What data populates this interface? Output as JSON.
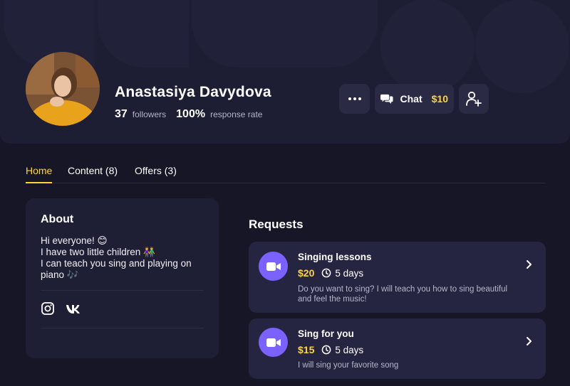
{
  "profile": {
    "name": "Anastasiya Davydova",
    "followers_count": "37",
    "followers_label": "followers",
    "response_rate": "100%",
    "response_label": "response rate"
  },
  "actions": {
    "more_icon": "more-horizontal-icon",
    "chat_label": "Chat",
    "chat_price": "$10",
    "follow_icon": "user-plus-icon"
  },
  "tabs": [
    {
      "label": "Home",
      "active": true
    },
    {
      "label": "Content (8)",
      "active": false
    },
    {
      "label": "Offers (3)",
      "active": false
    }
  ],
  "about": {
    "title": "About",
    "lines": [
      "Hi everyone! 😊",
      "I have two little children 👫",
      "I can teach you sing and playing on",
      "piano 🎶"
    ],
    "social": [
      "instagram-icon",
      "vk-icon"
    ]
  },
  "requests": {
    "title": "Requests",
    "items": [
      {
        "title": "Singing lessons",
        "price": "$20",
        "duration": "5 days",
        "description": "Do you want to sing? I will teach you how to sing beautiful and feel the music!"
      },
      {
        "title": "Sing for you",
        "price": "$15",
        "duration": "5 days",
        "description": "I will sing your favorite song"
      }
    ]
  },
  "colors": {
    "background": "#161627",
    "header": "#1d1d33",
    "card": "#252542",
    "accent": "#ffd43b",
    "video": "#7b61ff"
  }
}
